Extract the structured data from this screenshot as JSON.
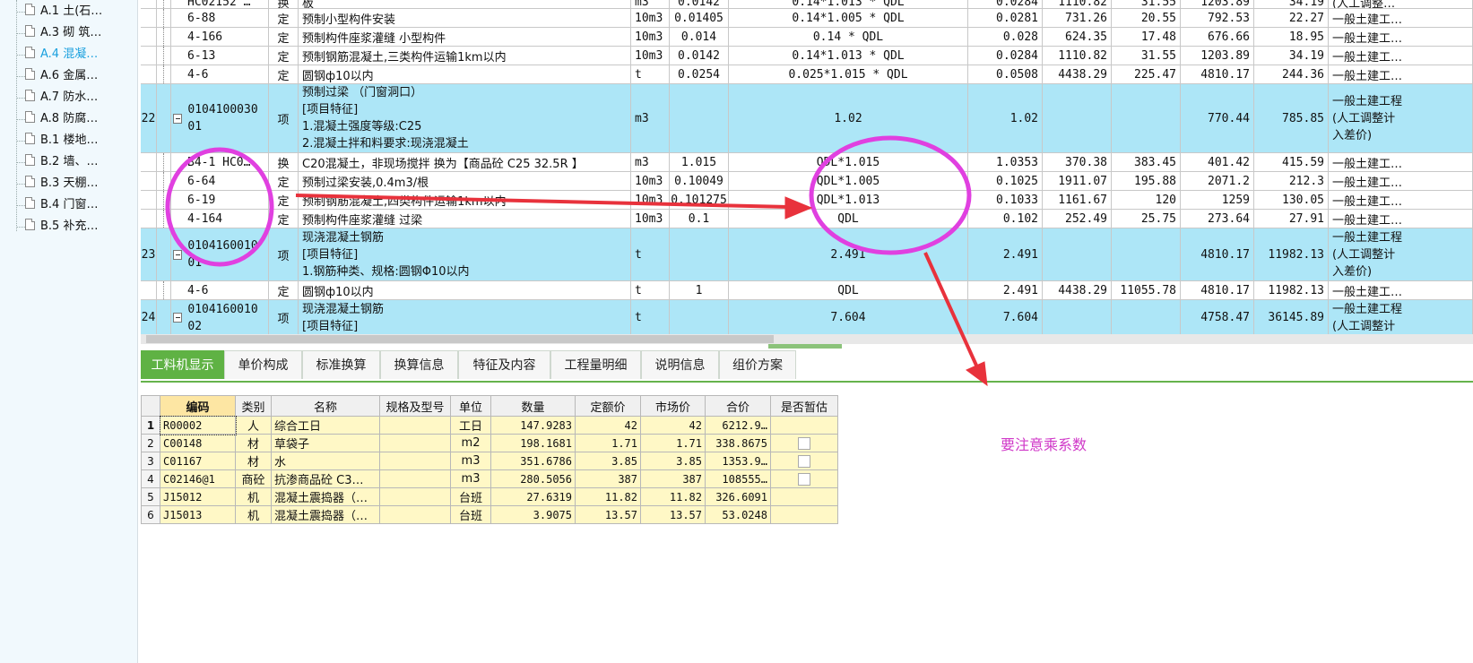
{
  "sidebar": {
    "items": [
      {
        "label": "A.1 土(石…",
        "selected": false
      },
      {
        "label": "A.3 砌 筑…",
        "selected": false
      },
      {
        "label": "A.4 混凝…",
        "selected": true
      },
      {
        "label": "A.6 金属…",
        "selected": false
      },
      {
        "label": "A.7 防水…",
        "selected": false
      },
      {
        "label": "A.8 防腐…",
        "selected": false
      },
      {
        "label": "B.1 楼地…",
        "selected": false
      },
      {
        "label": "B.2 墙、…",
        "selected": false
      },
      {
        "label": "B.3 天棚…",
        "selected": false
      },
      {
        "label": "B.4 门窗…",
        "selected": false
      },
      {
        "label": "B.5 补充…",
        "selected": false
      }
    ]
  },
  "grid": {
    "rows": [
      {
        "idx": "",
        "code": "HC02152 …",
        "type": "换",
        "name": "板",
        "unit": "m3",
        "qty": "0.0142",
        "expr": "0.14*1.013 * QDL",
        "amount": "0.0284",
        "p1": "1110.82",
        "p2": "31.55",
        "p3": "1203.89",
        "p4": "34.19",
        "spec": "(人工调整…"
      },
      {
        "idx": "",
        "code": "6-88",
        "type": "定",
        "name": "预制小型构件安装",
        "unit": "10m3",
        "qty": "0.01405",
        "expr": "0.14*1.005 * QDL",
        "amount": "0.0281",
        "p1": "731.26",
        "p2": "20.55",
        "p3": "792.53",
        "p4": "22.27",
        "spec": "一般土建工…"
      },
      {
        "idx": "",
        "code": "4-166",
        "type": "定",
        "name": "预制构件座浆灌缝 小型构件",
        "unit": "10m3",
        "qty": "0.014",
        "expr": "0.14 * QDL",
        "amount": "0.028",
        "p1": "624.35",
        "p2": "17.48",
        "p3": "676.66",
        "p4": "18.95",
        "spec": "一般土建工…"
      },
      {
        "idx": "",
        "code": "6-13",
        "type": "定",
        "name": "预制钢筋混凝土,三类构件运输1km以内",
        "unit": "10m3",
        "qty": "0.0142",
        "expr": "0.14*1.013 * QDL",
        "amount": "0.0284",
        "p1": "1110.82",
        "p2": "31.55",
        "p3": "1203.89",
        "p4": "34.19",
        "spec": "一般土建工…"
      },
      {
        "idx": "",
        "code": "4-6",
        "type": "定",
        "name": "圆钢ф10以内",
        "unit": "t",
        "qty": "0.0254",
        "expr": "0.025*1.015 * QDL",
        "amount": "0.0508",
        "p1": "4438.29",
        "p2": "225.47",
        "p3": "4810.17",
        "p4": "244.36",
        "spec": "一般土建工…"
      },
      {
        "idx": "22",
        "code": "010410003001",
        "type": "项",
        "name": "预制过梁 （门窗洞口）\n[项目特征]\n1.混凝土强度等级:C25\n2.混凝土拌和料要求:现浇混凝土",
        "unit": "m3",
        "qty": "",
        "expr": "1.02",
        "amount": "1.02",
        "p1": "",
        "p2": "",
        "p3": "770.44",
        "p4": "785.85",
        "spec": "一般土建工程\n(人工调整计\n入差价)"
      },
      {
        "idx": "",
        "code": "B4-1 HC0…",
        "type": "换",
        "name": "C20混凝土，非现场搅拌  换为【商品砼 C25 32.5R 】",
        "unit": "m3",
        "qty": "1.015",
        "expr": "QDL*1.015",
        "amount": "1.0353",
        "p1": "370.38",
        "p2": "383.45",
        "p3": "401.42",
        "p4": "415.59",
        "spec": "一般土建工…"
      },
      {
        "idx": "",
        "code": "6-64",
        "type": "定",
        "name": "预制过梁安装,0.4m3/根",
        "unit": "10m3",
        "qty": "0.10049",
        "expr": "QDL*1.005",
        "amount": "0.1025",
        "p1": "1911.07",
        "p2": "195.88",
        "p3": "2071.2",
        "p4": "212.3",
        "spec": "一般土建工…"
      },
      {
        "idx": "",
        "code": "6-19",
        "type": "定",
        "name": "预制钢筋混凝土,四类构件运输1km以内",
        "unit": "10m3",
        "qty": "0.101275",
        "expr": "QDL*1.013",
        "amount": "0.1033",
        "p1": "1161.67",
        "p2": "120",
        "p3": "1259",
        "p4": "130.05",
        "spec": "一般土建工…"
      },
      {
        "idx": "",
        "code": "4-164",
        "type": "定",
        "name": "预制构件座浆灌缝 过梁",
        "unit": "10m3",
        "qty": "0.1",
        "expr": "QDL",
        "amount": "0.102",
        "p1": "252.49",
        "p2": "25.75",
        "p3": "273.64",
        "p4": "27.91",
        "spec": "一般土建工…"
      },
      {
        "idx": "23",
        "code": "010416001001",
        "type": "项",
        "name": "现浇混凝土钢筋\n[项目特征]\n1.钢筋种类、规格:圆钢Φ10以内",
        "unit": "t",
        "qty": "",
        "expr": "2.491",
        "amount": "2.491",
        "p1": "",
        "p2": "",
        "p3": "4810.17",
        "p4": "11982.13",
        "spec": "一般土建工程\n(人工调整计\n入差价)"
      },
      {
        "idx": "",
        "code": "4-6",
        "type": "定",
        "name": "圆钢ф10以内",
        "unit": "t",
        "qty": "1",
        "expr": "QDL",
        "amount": "2.491",
        "p1": "4438.29",
        "p2": "11055.78",
        "p3": "4810.17",
        "p4": "11982.13",
        "spec": "一般土建工…"
      },
      {
        "idx": "24",
        "code": "010416001002",
        "type": "项",
        "name": "现浇混凝土钢筋\n[项目特征]",
        "unit": "t",
        "qty": "",
        "expr": "7.604",
        "amount": "7.604",
        "p1": "",
        "p2": "",
        "p3": "4758.47",
        "p4": "36145.89",
        "spec": "一般土建工程\n(人工调整计"
      }
    ]
  },
  "tabs": [
    "工料机显示",
    "单价构成",
    "标准换算",
    "换算信息",
    "特征及内容",
    "工程量明细",
    "说明信息",
    "组价方案"
  ],
  "lower": {
    "headers": [
      "编码",
      "类别",
      "名称",
      "规格及型号",
      "单位",
      "数量",
      "定额价",
      "市场价",
      "合价",
      "是否暂估"
    ],
    "rows": [
      {
        "n": "1",
        "code": "R00002",
        "cat": "人",
        "name": "综合工日",
        "spec": "",
        "unit": "工日",
        "qty": "147.9283",
        "price": "42",
        "market": "42",
        "total": "6212.9…",
        "est": false
      },
      {
        "n": "2",
        "code": "C00148",
        "cat": "材",
        "name": "草袋子",
        "spec": "",
        "unit": "m2",
        "qty": "198.1681",
        "price": "1.71",
        "market": "1.71",
        "total": "338.8675",
        "est": true
      },
      {
        "n": "3",
        "code": "C01167",
        "cat": "材",
        "name": "水",
        "spec": "",
        "unit": "m3",
        "qty": "351.6786",
        "price": "3.85",
        "market": "3.85",
        "total": "1353.9…",
        "est": true
      },
      {
        "n": "4",
        "code": "C02146@1",
        "cat": "商砼",
        "name": "抗渗商品砼 C3…",
        "spec": "",
        "unit": "m3",
        "qty": "280.5056",
        "price": "387",
        "market": "387",
        "total": "108555…",
        "est": true
      },
      {
        "n": "5",
        "code": "J15012",
        "cat": "机",
        "name": "混凝土震捣器（…",
        "spec": "",
        "unit": "台班",
        "qty": "27.6319",
        "price": "11.82",
        "market": "11.82",
        "total": "326.6091",
        "est": false
      },
      {
        "n": "6",
        "code": "J15013",
        "cat": "机",
        "name": "混凝土震捣器（…",
        "spec": "",
        "unit": "台班",
        "qty": "3.9075",
        "price": "13.57",
        "market": "13.57",
        "total": "53.0248",
        "est": false
      }
    ]
  },
  "annotation": {
    "note": "要注意乘系数",
    "color": "#d038c8",
    "arrow_color": "#e8323c"
  }
}
